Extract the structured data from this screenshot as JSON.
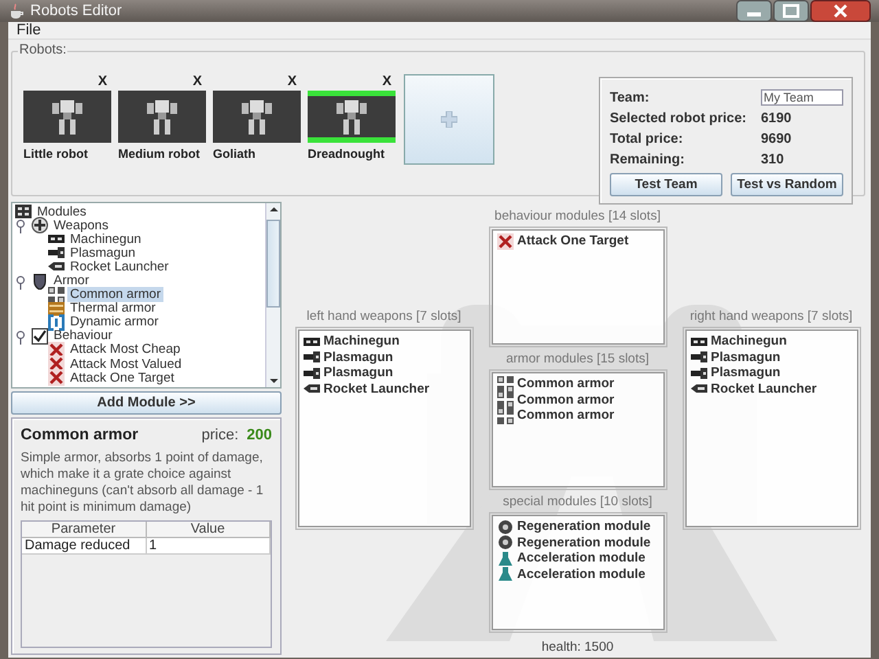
{
  "window": {
    "title": "Robots Editor"
  },
  "menu": [
    "File"
  ],
  "robots": {
    "label": "Robots:",
    "items": [
      {
        "name": "Little robot",
        "remove": "X",
        "selected": false
      },
      {
        "name": "Medium robot",
        "remove": "X",
        "selected": false
      },
      {
        "name": "Goliath",
        "remove": "X",
        "selected": false
      },
      {
        "name": "Dreadnought",
        "remove": "X",
        "selected": true
      }
    ]
  },
  "team": {
    "team_label": "Team:",
    "team_value": "My Team",
    "rows": [
      {
        "label": "Selected robot price:",
        "value": "6190"
      },
      {
        "label": "Total price:",
        "value": "9690"
      },
      {
        "label": "Remaining:",
        "value": "310"
      }
    ],
    "buttons": [
      "Test Team",
      "Test vs Random"
    ]
  },
  "tree": {
    "label": "Modules",
    "kind": "root",
    "children": [
      {
        "label": "Weapons",
        "kind": "weapons",
        "expanded": true,
        "children": [
          {
            "label": "Machinegun",
            "kind": "machinegun",
            "selected": false
          },
          {
            "label": "Plasmagun",
            "kind": "plasmagun",
            "selected": false
          },
          {
            "label": "Rocket Launcher",
            "kind": "rocket",
            "selected": false
          }
        ]
      },
      {
        "label": "Armor",
        "kind": "armor_group",
        "expanded": true,
        "children": [
          {
            "label": "Common armor",
            "kind": "armor",
            "selected": true
          },
          {
            "label": "Thermal armor",
            "kind": "thermal",
            "selected": false
          },
          {
            "label": "Dynamic armor",
            "kind": "dynamic",
            "selected": false
          }
        ]
      },
      {
        "label": "Behaviour",
        "kind": "behaviour_group",
        "expanded": true,
        "children": [
          {
            "label": "Attack Most Cheap",
            "kind": "behaviour",
            "selected": false
          },
          {
            "label": "Attack Most Valued",
            "kind": "behaviour",
            "selected": false
          },
          {
            "label": "Attack One Target",
            "kind": "behaviour",
            "selected": false
          }
        ]
      }
    ]
  },
  "add_button": "Add Module >>",
  "details": {
    "name": "Common armor",
    "price_label": "price:",
    "price": "200",
    "description": "Simple armor, absorbs 1 point of damage, which make it a grate choice against machineguns (can't absorb all damage - 1 hit point is minimum damage)",
    "columns": [
      "Parameter",
      "Value"
    ],
    "rows": [
      [
        "Damage reduced",
        "1"
      ]
    ]
  },
  "slots": {
    "behaviour": {
      "title": "behaviour modules [14 slots]",
      "items": [
        {
          "name": "Attack One Target",
          "kind": "behaviour"
        }
      ]
    },
    "left": {
      "title": "left hand weapons [7 slots]",
      "items": [
        {
          "name": "Machinegun",
          "kind": "machinegun"
        },
        {
          "name": "Plasmagun",
          "kind": "plasmagun"
        },
        {
          "name": "Plasmagun",
          "kind": "plasmagun"
        },
        {
          "name": "Rocket Launcher",
          "kind": "rocket"
        }
      ]
    },
    "armor": {
      "title": "armor modules [15 slots]",
      "items": [
        {
          "name": "Common armor",
          "kind": "armor"
        },
        {
          "name": "Common armor",
          "kind": "armor"
        },
        {
          "name": "Common armor",
          "kind": "armor"
        }
      ]
    },
    "right": {
      "title": "right hand weapons [7 slots]",
      "items": [
        {
          "name": "Machinegun",
          "kind": "machinegun"
        },
        {
          "name": "Plasmagun",
          "kind": "plasmagun"
        },
        {
          "name": "Plasmagun",
          "kind": "plasmagun"
        },
        {
          "name": "Rocket Launcher",
          "kind": "rocket"
        }
      ]
    },
    "special": {
      "title": "special modules [10 slots]",
      "items": [
        {
          "name": "Regeneration module",
          "kind": "regeneration"
        },
        {
          "name": "Regeneration module",
          "kind": "regeneration"
        },
        {
          "name": "Acceleration module",
          "kind": "acceleration"
        },
        {
          "name": "Acceleration module",
          "kind": "acceleration"
        }
      ]
    }
  },
  "health": "health: 1500"
}
